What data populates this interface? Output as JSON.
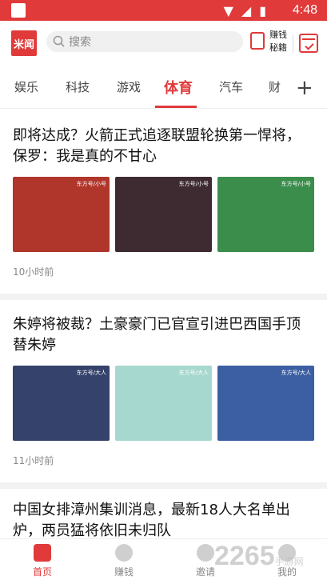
{
  "status_bar": {
    "time": "4:48"
  },
  "header": {
    "logo_text": "米闻",
    "search_placeholder": "搜索",
    "earn_label": "赚钱\n秘籍"
  },
  "tabs": {
    "items": [
      "娱乐",
      "科技",
      "游戏",
      "体育",
      "汽车",
      "财"
    ],
    "active": "体育",
    "plus": "+"
  },
  "articles": [
    {
      "title": "即将达成？火箭正式追逐联盟轮换第一悍将，保罗：我是真的不甘心",
      "time": "10小时前",
      "thumb_colors": [
        "#b0352b",
        "#3e2b32",
        "#3b8d4c"
      ],
      "watermark": "东方号/小号"
    },
    {
      "title": "朱婷将被裁？土豪豪门已官宣引进巴西国手顶替朱婷",
      "time": "11小时前",
      "thumb_colors": [
        "#35426b",
        "#a7d8cf",
        "#3c5fa3"
      ],
      "watermark": "东方号/大人"
    },
    {
      "title": "中国女排漳州集训消息，最新18人大名单出炉，两员猛将依旧未归队",
      "time": ""
    }
  ],
  "bottom_nav": {
    "items": [
      "首页",
      "赚钱",
      "邀请",
      "我的"
    ],
    "active": "首页"
  },
  "watermark": {
    "text": "2265",
    "sub": "手游网"
  },
  "colors": {
    "accent": "#e03a3a"
  }
}
